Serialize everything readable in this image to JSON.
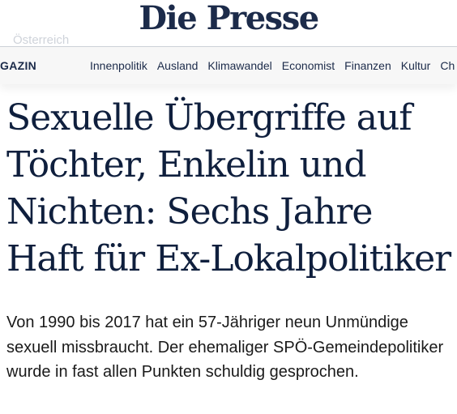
{
  "masthead": {
    "logo": "Die Presse",
    "ghost_label": "Österreich"
  },
  "nav": {
    "first_item": "GAZIN",
    "items": [
      {
        "label": "Innenpolitik"
      },
      {
        "label": "Ausland"
      },
      {
        "label": "Klimawandel"
      },
      {
        "label": "Economist"
      },
      {
        "label": "Finanzen"
      },
      {
        "label": "Kultur"
      },
      {
        "label": "Ch"
      }
    ]
  },
  "article": {
    "headline": "Sexuelle Übergriffe auf Töchter, Enkelin und Nichten: Sechs Jahre Haft für Ex-Lokalpolitiker",
    "lead": "Von 1990 bis 2017 hat ein 57-Jähriger neun Unmündige sexuell missbraucht. Der ehemaliger SPÖ-Gemeindepolitiker wurde in fast allen Punkten schuldig gesprochen."
  },
  "colors": {
    "brand_navy": "#1c2b4a",
    "headline": "#0f1f3d",
    "nav_background": "#f7f7f7"
  }
}
